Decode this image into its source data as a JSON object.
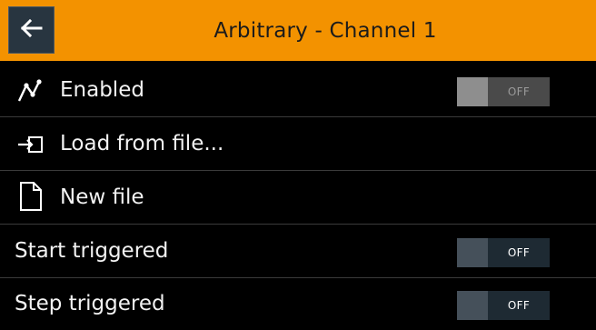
{
  "header": {
    "title": "Arbitrary - Channel 1",
    "back_icon": "arrow-left-icon"
  },
  "rows": [
    {
      "label": "Enabled",
      "icon": "waveform-icon",
      "toggle": "OFF",
      "toggle_enabled": false
    },
    {
      "label": "Load from file...",
      "icon": "load-file-icon"
    },
    {
      "label": "New file",
      "icon": "new-file-icon"
    },
    {
      "label": "Start triggered",
      "toggle": "OFF",
      "toggle_enabled": true
    },
    {
      "label": "Step triggered",
      "toggle": "OFF",
      "toggle_enabled": true
    }
  ],
  "colors": {
    "header_bg": "#f39200",
    "background": "#000000",
    "toggle_bg": "#1e2a33",
    "toggle_disabled_bg": "#4a4a4a"
  }
}
